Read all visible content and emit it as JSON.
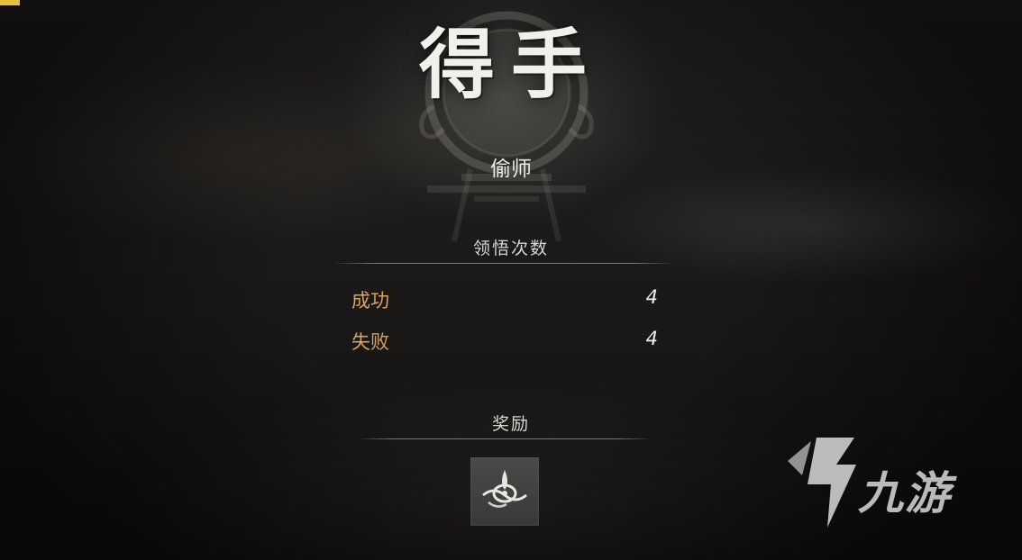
{
  "result": {
    "title": "得手",
    "subtitle": "偷师"
  },
  "insight_section": {
    "label": "领悟次数",
    "stats": [
      {
        "label": "成功",
        "value": "4"
      },
      {
        "label": "失败",
        "value": "4"
      }
    ]
  },
  "reward_section": {
    "label": "奖励",
    "item_icon": "swirl-emblem-icon"
  },
  "watermark": {
    "text": "九游",
    "logo_icon": "jiuyou-logo-icon"
  },
  "colors": {
    "stat_label": "#d9a35a",
    "value_text": "#f3f1ec",
    "corner_accent": "#e6c03a"
  }
}
